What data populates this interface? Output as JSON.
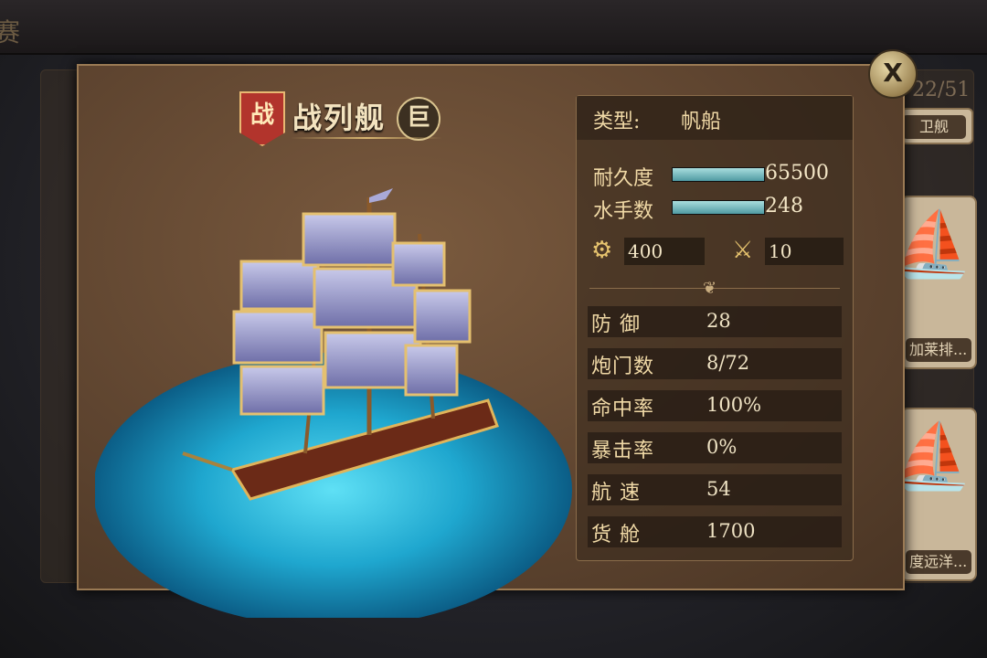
{
  "background": {
    "top_glyph": "赛",
    "fleet_count": "22/51",
    "side_cards": [
      {
        "label": "卫舰"
      },
      {
        "label": "加莱排..."
      },
      {
        "label": "度远洋..."
      }
    ]
  },
  "dialog": {
    "close_label": "X",
    "category_badge": "战",
    "ship_name": "战列舰",
    "size_badge": "巨",
    "type": {
      "label": "类型:",
      "value": "帆船"
    },
    "bars": [
      {
        "label": "耐久度",
        "value": "65500",
        "fill": 1.0
      },
      {
        "label": "水手数",
        "value": "248",
        "fill": 1.0
      }
    ],
    "cannon": {
      "icon": "cannon-icon",
      "value": "400"
    },
    "melee": {
      "icon": "crossed-swords-icon",
      "value": "10"
    },
    "stats": [
      {
        "label": "防 御",
        "value": "28"
      },
      {
        "label": "炮门数",
        "value": "8/72"
      },
      {
        "label": "命中率",
        "value": "100%"
      },
      {
        "label": "暴击率",
        "value": "0%"
      },
      {
        "label": "航 速",
        "value": "54"
      },
      {
        "label": "货 舱",
        "value": "1700"
      }
    ]
  },
  "colors": {
    "accent_gold": "#d9b772",
    "bar_fill": "#7fc7cc",
    "badge_red": "#b2342c"
  }
}
